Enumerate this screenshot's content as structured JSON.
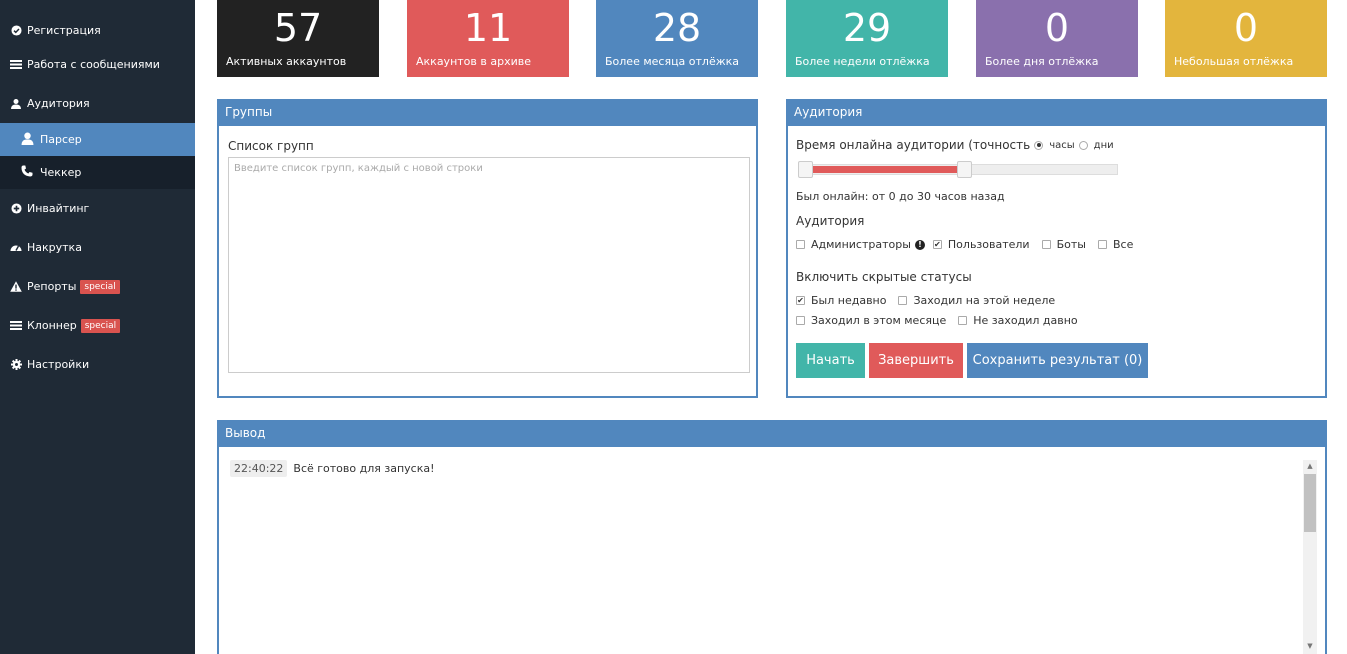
{
  "sidebar": {
    "items": [
      {
        "label": "Регистрация",
        "icon": "check-circle-icon"
      },
      {
        "label": "Работа с сообщениями",
        "icon": "list-icon"
      },
      {
        "label": "Аудитория",
        "icon": "users-icon"
      },
      {
        "label": "Парсер",
        "icon": "user-icon"
      },
      {
        "label": "Чеккер",
        "icon": "phone-icon"
      },
      {
        "label": "Инвайтинг",
        "icon": "plus-circle-icon"
      },
      {
        "label": "Накрутка",
        "icon": "tachometer-icon"
      },
      {
        "label": "Репорты",
        "icon": "warning-icon",
        "badge": "special"
      },
      {
        "label": "Клоннер",
        "icon": "clone-icon",
        "badge": "special"
      },
      {
        "label": "Настройки",
        "icon": "gear-icon"
      }
    ]
  },
  "stats": [
    {
      "value": "57",
      "label": "Активных аккаунтов",
      "color": "#222222"
    },
    {
      "value": "11",
      "label": "Аккаунтов в архиве",
      "color": "#e05a5a"
    },
    {
      "value": "28",
      "label": "Более месяца отлёжка",
      "color": "#5187be"
    },
    {
      "value": "29",
      "label": "Более недели отлёжка",
      "color": "#42b5a9"
    },
    {
      "value": "0",
      "label": "Более дня отлёжка",
      "color": "#8a70ad"
    },
    {
      "value": "0",
      "label": "Небольшая отлёжка",
      "color": "#e3b53d"
    }
  ],
  "groups": {
    "title": "Группы",
    "list_label": "Список групп",
    "placeholder": "Введите список групп, каждый с новой строки"
  },
  "audience": {
    "title": "Аудитория",
    "online_label": "Время онлайна аудитории (точность",
    "unit_hours": "часы",
    "unit_days": "дни",
    "range_text": "Был онлайн: от 0 до 30 часов назад",
    "range_fill_percent": 49,
    "audience_label": "Аудитория",
    "types": [
      {
        "label": "Администраторы",
        "checked": false
      },
      {
        "label": "Пользователи",
        "checked": true
      },
      {
        "label": "Боты",
        "checked": false
      },
      {
        "label": "Все",
        "checked": false
      }
    ],
    "hidden_label": "Включить скрытые статусы",
    "statuses": [
      {
        "label": "Был недавно",
        "checked": true
      },
      {
        "label": "Заходил на этой неделе",
        "checked": false
      },
      {
        "label": "Заходил в этом месяце",
        "checked": false
      },
      {
        "label": "Не заходил давно",
        "checked": false
      }
    ],
    "buttons": {
      "start": "Начать",
      "finish": "Завершить",
      "save": "Сохранить результат (0)"
    },
    "colors": {
      "start": "#42b5a9",
      "finish": "#e05a5a",
      "save": "#5187be"
    }
  },
  "output": {
    "title": "Вывод",
    "log": [
      {
        "time": "22:40:22",
        "message": "Всё готово для запуска!"
      }
    ]
  }
}
